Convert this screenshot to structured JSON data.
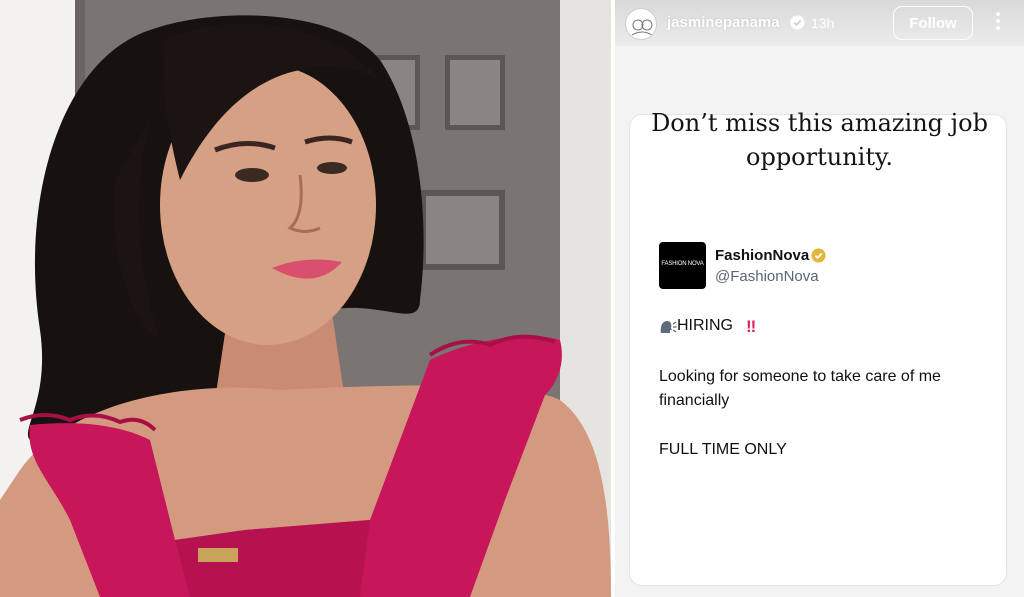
{
  "story": {
    "username": "jasminepanama",
    "time_ago": "13h",
    "follow_label": "Follow",
    "headline_line1": "Don’t miss this amazing job",
    "headline_line2": "opportunity."
  },
  "tweet": {
    "logo_text": "FASHION NOVA",
    "display_name": "FashionNova",
    "handle": "@FashionNova",
    "hiring_text": "HIRING",
    "hiring_emoji": "‼",
    "line1": "Looking for someone to take care of me",
    "line2": "financially",
    "line3": "FULL TIME ONLY"
  },
  "icons": {
    "verified": "verified-badge-icon",
    "gold_verified": "gold-verified-badge-icon",
    "speaking_head": "speaking-head-icon",
    "more": "more-options-icon"
  },
  "colors": {
    "dress_pink": "#c8165b",
    "gold_badge": "#e2b53c",
    "double_exclamation": "#e0245e"
  }
}
